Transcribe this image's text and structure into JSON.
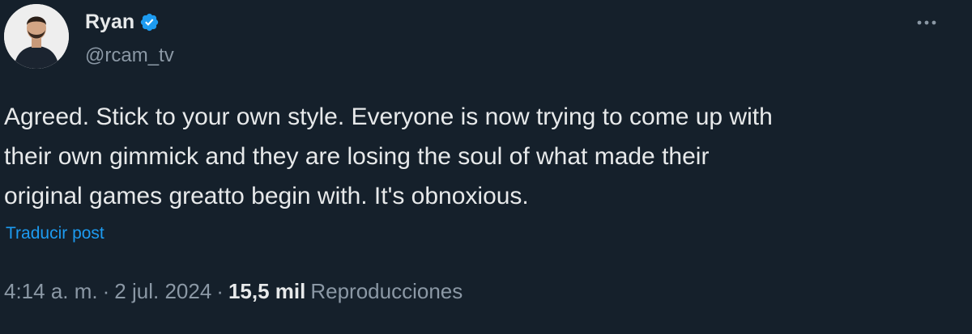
{
  "author": {
    "display_name": "Ryan",
    "handle": "@rcam_tv",
    "verified_icon": "verified-badge-icon",
    "avatar_icon": "profile-photo"
  },
  "menu": {
    "more_icon": "more-horizontal-icon"
  },
  "tweet": {
    "text": "Agreed. Stick to your own style. Everyone is now trying to come up with\ntheir own gimmick and they are losing the soul of what made their\noriginal games greatto begin with. It's obnoxious.",
    "translate_label": "Traducir post"
  },
  "meta": {
    "time": "4:14 a. m.",
    "separator": "·",
    "date": "2 jul. 2024",
    "views_count": "15,5 mil",
    "views_label": "Reproducciones"
  },
  "colors": {
    "background": "#15202b",
    "text_primary": "#e7e9ea",
    "text_secondary": "#8b98a5",
    "accent": "#1d9bf0"
  }
}
